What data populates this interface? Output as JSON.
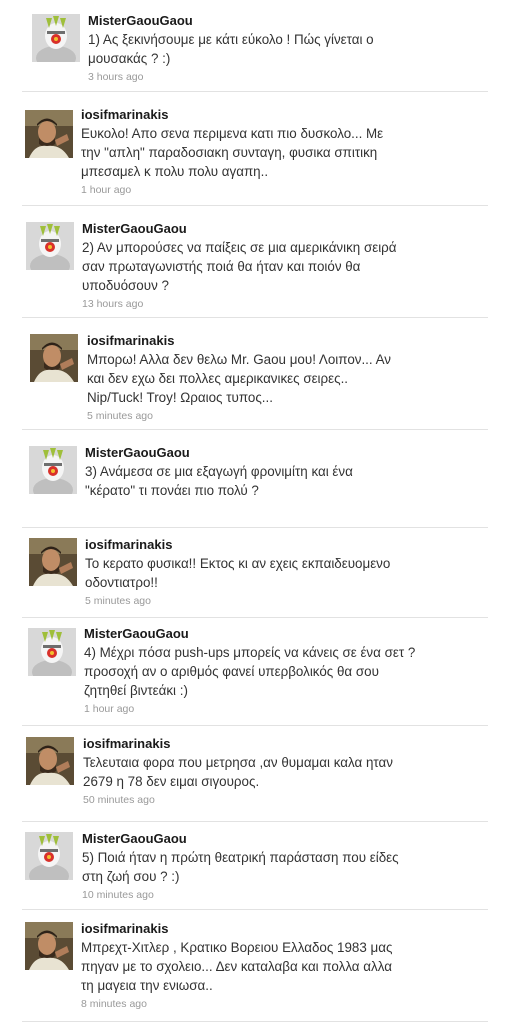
{
  "tweets": [
    {
      "user": "MisterGaouGaou",
      "text": "1) Ας ξεκινήσουμε με κάτι εύκολο ! Πώς γίνεται ο\nμουσακάς ? :)",
      "time": "3 hours ago",
      "avatar": "mistergaougaou-avatar-icon"
    },
    {
      "user": "iosifmarinakis",
      "text": "Ευκολο! Απο σενα περιμενα κατι πιο δυσκολο... Με\nτην \"απλη\" παραδοσιακη συνταγη, φυσικα σπιτικη\nμπεσαμελ κ πολυ πολυ αγαπη..",
      "time": "1 hour ago",
      "avatar": "iosifmarinakis-avatar-photo"
    },
    {
      "user": "MisterGaouGaou",
      "text": "2) Αν μπορούσες να παίξεις σε μια αμερικάνικη σειρά\nσαν πρωταγωνιστής ποιά θα ήταν και ποιόν θα\nυποδυόσουν ?",
      "time": "13 hours ago",
      "avatar": "mistergaougaou-avatar-icon"
    },
    {
      "user": "iosifmarinakis",
      "text": "Μπορω! Αλλα δεν θελω Mr. Gaou μου! Λοιπον... Αν\nκαι δεν εχω δει πολλες αμερικανικες σειρες..\nNip/Tuck! Troy! Ωραιος τυπος...",
      "time": "5 minutes ago",
      "avatar": "iosifmarinakis-avatar-photo"
    },
    {
      "user": "MisterGaouGaou",
      "text": "3) Ανάμεσα σε μια εξαγωγή φρονιμίτη και ένα\n\"κέρατο\" τι πονάει πιο πολύ ?",
      "time": "",
      "avatar": "mistergaougaou-avatar-icon"
    },
    {
      "user": "iosifmarinakis",
      "text": "Το κερατο φυσικα!! Εκτος κι αν εχεις εκπαιδευομενο\nοδοντιατρο!!",
      "time": "5 minutes ago",
      "avatar": "iosifmarinakis-avatar-photo"
    },
    {
      "user": "MisterGaouGaou",
      "text": "4) Μέχρι πόσα push-ups μπορείς να κάνεις σε ένα σετ ?\nπροσοχή αν ο αριθμός φανεί υπερβολικός θα σου\nζητηθεί βιντεάκι :)",
      "time": "1 hour ago",
      "avatar": "mistergaougaou-avatar-icon"
    },
    {
      "user": "iosifmarinakis",
      "text": "Τελευταια φορα που μετρησα ,αν θυμαμαι καλα ηταν\n2679 η 78 δεν ειμαι σιγουρος.",
      "time": "50 minutes ago",
      "avatar": "iosifmarinakis-avatar-photo"
    },
    {
      "user": "MisterGaouGaou",
      "text": "5) Ποιά ήταν η πρώτη θεατρική παράσταση που είδες\nστη ζωή σου ? :)",
      "time": "10 minutes ago",
      "avatar": "mistergaougaou-avatar-icon"
    },
    {
      "user": "iosifmarinakis",
      "text": "Μπρεχτ-Χιτλερ , Κρατικο Βορειου Ελλαδος 1983 μας\nπηγαν με το σχολειο... Δεν καταλαβα και πολλα αλλα\nτη μαγεια την ενιωσα..",
      "time": "8 minutes ago",
      "avatar": "iosifmarinakis-avatar-photo"
    }
  ]
}
